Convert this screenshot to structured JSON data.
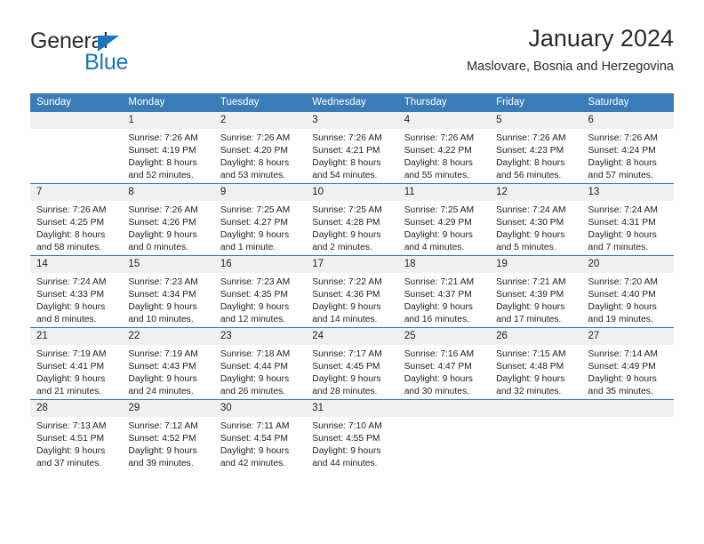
{
  "brand": {
    "line1": "General",
    "line2": "Blue",
    "accent_color": "#1b75bb"
  },
  "header": {
    "title": "January 2024",
    "subtitle": "Maslovare, Bosnia and Herzegovina"
  },
  "theme": {
    "header_blue": "#3a7cb8",
    "daynum_band": "#f0f0f0",
    "text": "#222222"
  },
  "weekday_headers": [
    "Sunday",
    "Monday",
    "Tuesday",
    "Wednesday",
    "Thursday",
    "Friday",
    "Saturday"
  ],
  "weeks": [
    [
      {
        "day": "",
        "sunrise": "",
        "sunset": "",
        "daylight1": "",
        "daylight2": "",
        "empty": true
      },
      {
        "day": "1",
        "sunrise": "Sunrise: 7:26 AM",
        "sunset": "Sunset: 4:19 PM",
        "daylight1": "Daylight: 8 hours",
        "daylight2": "and 52 minutes."
      },
      {
        "day": "2",
        "sunrise": "Sunrise: 7:26 AM",
        "sunset": "Sunset: 4:20 PM",
        "daylight1": "Daylight: 8 hours",
        "daylight2": "and 53 minutes."
      },
      {
        "day": "3",
        "sunrise": "Sunrise: 7:26 AM",
        "sunset": "Sunset: 4:21 PM",
        "daylight1": "Daylight: 8 hours",
        "daylight2": "and 54 minutes."
      },
      {
        "day": "4",
        "sunrise": "Sunrise: 7:26 AM",
        "sunset": "Sunset: 4:22 PM",
        "daylight1": "Daylight: 8 hours",
        "daylight2": "and 55 minutes."
      },
      {
        "day": "5",
        "sunrise": "Sunrise: 7:26 AM",
        "sunset": "Sunset: 4:23 PM",
        "daylight1": "Daylight: 8 hours",
        "daylight2": "and 56 minutes."
      },
      {
        "day": "6",
        "sunrise": "Sunrise: 7:26 AM",
        "sunset": "Sunset: 4:24 PM",
        "daylight1": "Daylight: 8 hours",
        "daylight2": "and 57 minutes."
      }
    ],
    [
      {
        "day": "7",
        "sunrise": "Sunrise: 7:26 AM",
        "sunset": "Sunset: 4:25 PM",
        "daylight1": "Daylight: 8 hours",
        "daylight2": "and 58 minutes."
      },
      {
        "day": "8",
        "sunrise": "Sunrise: 7:26 AM",
        "sunset": "Sunset: 4:26 PM",
        "daylight1": "Daylight: 9 hours",
        "daylight2": "and 0 minutes."
      },
      {
        "day": "9",
        "sunrise": "Sunrise: 7:25 AM",
        "sunset": "Sunset: 4:27 PM",
        "daylight1": "Daylight: 9 hours",
        "daylight2": "and 1 minute."
      },
      {
        "day": "10",
        "sunrise": "Sunrise: 7:25 AM",
        "sunset": "Sunset: 4:28 PM",
        "daylight1": "Daylight: 9 hours",
        "daylight2": "and 2 minutes."
      },
      {
        "day": "11",
        "sunrise": "Sunrise: 7:25 AM",
        "sunset": "Sunset: 4:29 PM",
        "daylight1": "Daylight: 9 hours",
        "daylight2": "and 4 minutes."
      },
      {
        "day": "12",
        "sunrise": "Sunrise: 7:24 AM",
        "sunset": "Sunset: 4:30 PM",
        "daylight1": "Daylight: 9 hours",
        "daylight2": "and 5 minutes."
      },
      {
        "day": "13",
        "sunrise": "Sunrise: 7:24 AM",
        "sunset": "Sunset: 4:31 PM",
        "daylight1": "Daylight: 9 hours",
        "daylight2": "and 7 minutes."
      }
    ],
    [
      {
        "day": "14",
        "sunrise": "Sunrise: 7:24 AM",
        "sunset": "Sunset: 4:33 PM",
        "daylight1": "Daylight: 9 hours",
        "daylight2": "and 8 minutes."
      },
      {
        "day": "15",
        "sunrise": "Sunrise: 7:23 AM",
        "sunset": "Sunset: 4:34 PM",
        "daylight1": "Daylight: 9 hours",
        "daylight2": "and 10 minutes."
      },
      {
        "day": "16",
        "sunrise": "Sunrise: 7:23 AM",
        "sunset": "Sunset: 4:35 PM",
        "daylight1": "Daylight: 9 hours",
        "daylight2": "and 12 minutes."
      },
      {
        "day": "17",
        "sunrise": "Sunrise: 7:22 AM",
        "sunset": "Sunset: 4:36 PM",
        "daylight1": "Daylight: 9 hours",
        "daylight2": "and 14 minutes."
      },
      {
        "day": "18",
        "sunrise": "Sunrise: 7:21 AM",
        "sunset": "Sunset: 4:37 PM",
        "daylight1": "Daylight: 9 hours",
        "daylight2": "and 16 minutes."
      },
      {
        "day": "19",
        "sunrise": "Sunrise: 7:21 AM",
        "sunset": "Sunset: 4:39 PM",
        "daylight1": "Daylight: 9 hours",
        "daylight2": "and 17 minutes."
      },
      {
        "day": "20",
        "sunrise": "Sunrise: 7:20 AM",
        "sunset": "Sunset: 4:40 PM",
        "daylight1": "Daylight: 9 hours",
        "daylight2": "and 19 minutes."
      }
    ],
    [
      {
        "day": "21",
        "sunrise": "Sunrise: 7:19 AM",
        "sunset": "Sunset: 4:41 PM",
        "daylight1": "Daylight: 9 hours",
        "daylight2": "and 21 minutes."
      },
      {
        "day": "22",
        "sunrise": "Sunrise: 7:19 AM",
        "sunset": "Sunset: 4:43 PM",
        "daylight1": "Daylight: 9 hours",
        "daylight2": "and 24 minutes."
      },
      {
        "day": "23",
        "sunrise": "Sunrise: 7:18 AM",
        "sunset": "Sunset: 4:44 PM",
        "daylight1": "Daylight: 9 hours",
        "daylight2": "and 26 minutes."
      },
      {
        "day": "24",
        "sunrise": "Sunrise: 7:17 AM",
        "sunset": "Sunset: 4:45 PM",
        "daylight1": "Daylight: 9 hours",
        "daylight2": "and 28 minutes."
      },
      {
        "day": "25",
        "sunrise": "Sunrise: 7:16 AM",
        "sunset": "Sunset: 4:47 PM",
        "daylight1": "Daylight: 9 hours",
        "daylight2": "and 30 minutes."
      },
      {
        "day": "26",
        "sunrise": "Sunrise: 7:15 AM",
        "sunset": "Sunset: 4:48 PM",
        "daylight1": "Daylight: 9 hours",
        "daylight2": "and 32 minutes."
      },
      {
        "day": "27",
        "sunrise": "Sunrise: 7:14 AM",
        "sunset": "Sunset: 4:49 PM",
        "daylight1": "Daylight: 9 hours",
        "daylight2": "and 35 minutes."
      }
    ],
    [
      {
        "day": "28",
        "sunrise": "Sunrise: 7:13 AM",
        "sunset": "Sunset: 4:51 PM",
        "daylight1": "Daylight: 9 hours",
        "daylight2": "and 37 minutes."
      },
      {
        "day": "29",
        "sunrise": "Sunrise: 7:12 AM",
        "sunset": "Sunset: 4:52 PM",
        "daylight1": "Daylight: 9 hours",
        "daylight2": "and 39 minutes."
      },
      {
        "day": "30",
        "sunrise": "Sunrise: 7:11 AM",
        "sunset": "Sunset: 4:54 PM",
        "daylight1": "Daylight: 9 hours",
        "daylight2": "and 42 minutes."
      },
      {
        "day": "31",
        "sunrise": "Sunrise: 7:10 AM",
        "sunset": "Sunset: 4:55 PM",
        "daylight1": "Daylight: 9 hours",
        "daylight2": "and 44 minutes."
      },
      {
        "day": "",
        "sunrise": "",
        "sunset": "",
        "daylight1": "",
        "daylight2": "",
        "empty": true
      },
      {
        "day": "",
        "sunrise": "",
        "sunset": "",
        "daylight1": "",
        "daylight2": "",
        "empty": true
      },
      {
        "day": "",
        "sunrise": "",
        "sunset": "",
        "daylight1": "",
        "daylight2": "",
        "empty": true
      }
    ]
  ]
}
